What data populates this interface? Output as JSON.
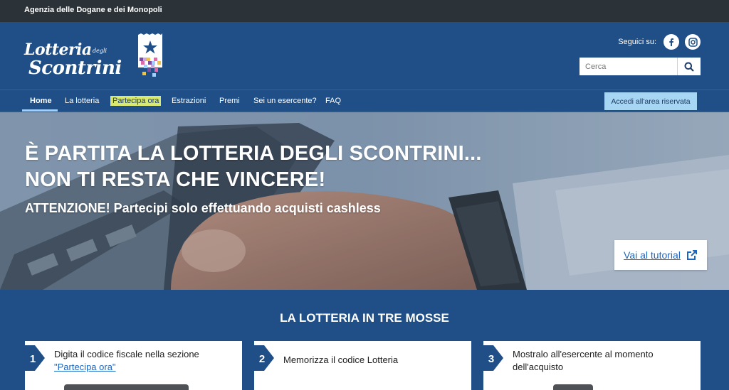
{
  "topbar": {
    "agency": "Agenzia delle Dogane e dei Monopoli"
  },
  "logo": {
    "line1": "Lotteria",
    "small": "degli",
    "line2": "Scontrini"
  },
  "social": {
    "label": "Seguici su:",
    "icons": [
      "facebook-icon",
      "instagram-icon"
    ]
  },
  "search": {
    "placeholder": "Cerca"
  },
  "nav": {
    "items": [
      "Home",
      "La lotteria",
      "Partecipa ora",
      "Estrazioni",
      "Premi",
      "Sei un esercente?",
      "FAQ"
    ],
    "active": "Home",
    "reserved": "Accedi all'area riservata"
  },
  "hero": {
    "line1": "È PARTITA LA LOTTERIA DEGLI SCONTRINI...",
    "line2": "NON TI RESTA CHE VINCERE!",
    "sub": "ATTENZIONE! Partecipi solo effettuando acquisti cashless",
    "tutorial": "Vai al tutorial"
  },
  "section": {
    "title": "LA LOTTERIA IN TRE MOSSE",
    "steps": [
      {
        "num": "1",
        "text": "Digita il codice fiscale nella sezione",
        "link": "\"Partecipa ora\""
      },
      {
        "num": "2",
        "text": "Memorizza il codice Lotteria"
      },
      {
        "num": "3",
        "text": "Mostralo all'esercente al momento dell'acquisto"
      }
    ]
  },
  "colors": {
    "brand_blue": "#1f4f86",
    "topbar": "#2b3339",
    "accent_light_blue": "#a7d6f5",
    "highlight": "#d9e86f",
    "link": "#1a66c4"
  }
}
